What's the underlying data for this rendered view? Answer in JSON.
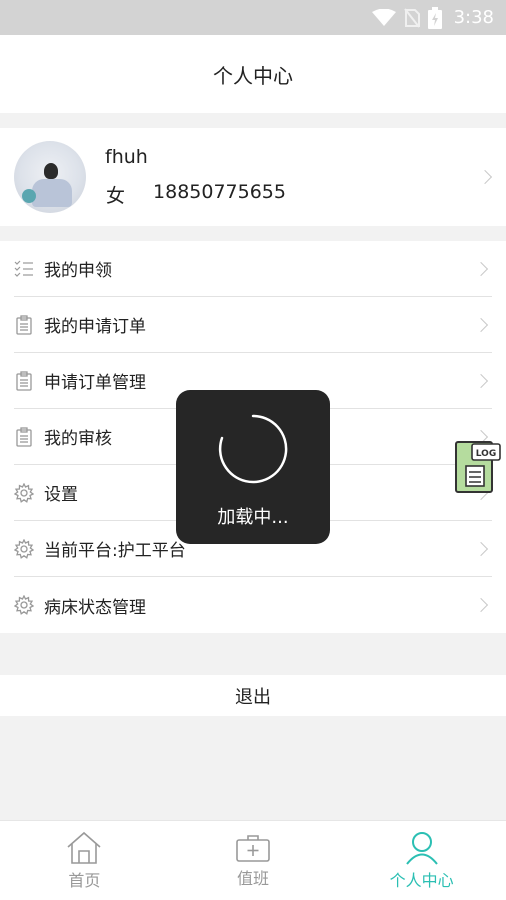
{
  "status_bar": {
    "time": "3:38",
    "icons": [
      "wifi-icon",
      "no-sim-icon",
      "battery-charging-icon"
    ]
  },
  "header": {
    "title": "个人中心"
  },
  "profile": {
    "name": "fhuh",
    "gender": "女",
    "phone": "18850775655"
  },
  "menu": {
    "items": [
      {
        "label": "我的申领",
        "icon": "list-icon"
      },
      {
        "label": "我的申请订单",
        "icon": "clipboard-icon"
      },
      {
        "label": "申请订单管理",
        "icon": "clipboard-icon"
      },
      {
        "label": "我的审核",
        "icon": "clipboard-icon"
      },
      {
        "label": "设置",
        "icon": "gear-icon"
      },
      {
        "label": "当前平台:护工平台",
        "icon": "gear-icon"
      },
      {
        "label": "病床状态管理",
        "icon": "gear-icon"
      }
    ]
  },
  "logout": {
    "label": "退出"
  },
  "tabs": [
    {
      "label": "首页",
      "icon": "home-icon",
      "active": false
    },
    {
      "label": "值班",
      "icon": "medical-kit-icon",
      "active": false
    },
    {
      "label": "个人中心",
      "icon": "person-icon",
      "active": true
    }
  ],
  "loading": {
    "text": "加载中..."
  },
  "log_button": {
    "label": "LOG"
  },
  "colors": {
    "accent": "#2bbfb3",
    "overlay": "#262626",
    "status_bar": "#d3d3d3",
    "log_green": "#b5dc9e"
  }
}
